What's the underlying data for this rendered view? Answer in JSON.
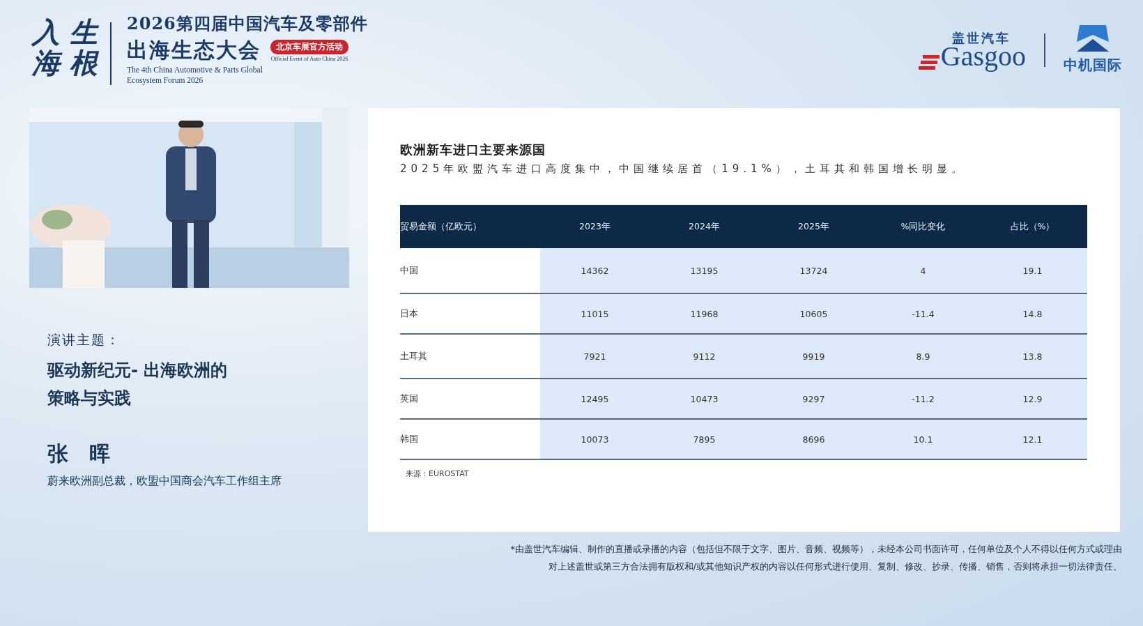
{
  "header": {
    "slogan_columns": [
      "入海",
      "生根"
    ],
    "title_line1": "2026第四届中国汽车及零部件",
    "title_line2": "出海生态大会",
    "badge": "北京车展官方活动",
    "badge_caption": "Official Event of Auto China 2026",
    "subtitle_lines": [
      "The 4th China Automotive & Parts Global",
      "Ecosystem Forum 2026"
    ],
    "partners": [
      {
        "kind": "gasgoo",
        "cn": "盖世汽车",
        "en": "Gasgoo"
      },
      {
        "kind": "zhongji",
        "cn": "中机国际"
      }
    ]
  },
  "talk": {
    "label": "演讲主题：",
    "title_lines": [
      "驱动新纪元- 出海欧洲的",
      "策略与实践"
    ],
    "speaker": "张　晖",
    "role": "蔚来欧洲副总裁，欧盟中国商会汽车工作组主席"
  },
  "slide": {
    "title": "欧洲新车进口主要来源国",
    "subtitle": "2025年欧盟汽车进口高度集中，中国继续居首（19.1%），土耳其和韩国增长明显。",
    "table": {
      "columns": [
        "贸易金额（亿欧元）",
        "2023年",
        "2024年",
        "2025年",
        "%同比变化",
        "占比（%）"
      ],
      "rows": [
        [
          "中国",
          "14362",
          "13195",
          "13724",
          "4",
          "19.1"
        ],
        [
          "日本",
          "11015",
          "11968",
          "10605",
          "-11.4",
          "14.8"
        ],
        [
          "土耳其",
          "7921",
          "9112",
          "9919",
          "8.9",
          "13.8"
        ],
        [
          "英国",
          "12495",
          "10473",
          "9297",
          "-11.2",
          "12.9"
        ],
        [
          "韩国",
          "10073",
          "7895",
          "8696",
          "10.1",
          "12.1"
        ]
      ]
    },
    "source": "来源：EUROSTAT"
  },
  "disclaimer": [
    "*由盖世汽车编辑、制作的直播或录播的内容（包括但不限于文字、图片、音频、视频等），未经本公司书面许可，任何单位及个人不得以任何方式或理由",
    "对上述盖世或第三方合法拥有版权和/或其他知识产权的内容以任何形式进行使用、复制、修改、抄录、传播、销售，否则将承担一切法律责任。"
  ]
}
